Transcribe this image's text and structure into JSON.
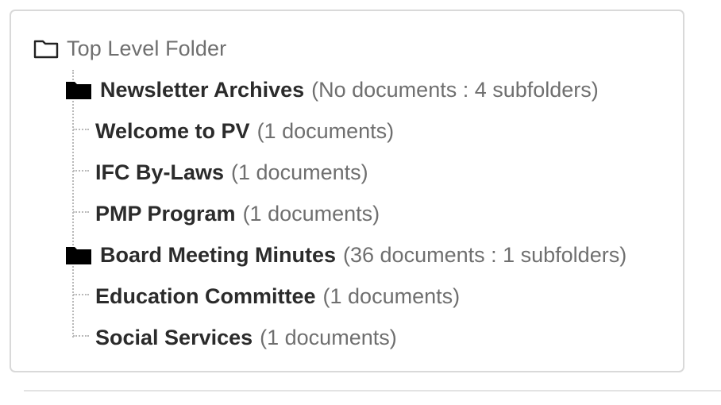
{
  "tree": {
    "root_label": "Top Level Folder",
    "items": [
      {
        "type": "folder",
        "name": "Newsletter Archives",
        "count": "(No documents : 4 subfolders)"
      },
      {
        "type": "document",
        "name": "Welcome to PV",
        "count": "(1 documents)"
      },
      {
        "type": "document",
        "name": "IFC By-Laws",
        "count": "(1 documents)"
      },
      {
        "type": "document",
        "name": "PMP Program",
        "count": "(1 documents)"
      },
      {
        "type": "folder",
        "name": "Board Meeting Minutes",
        "count": "(36 documents : 1 subfolders)"
      },
      {
        "type": "document",
        "name": "Education Committee",
        "count": "(1 documents)"
      },
      {
        "type": "document",
        "name": "Social Services",
        "count": "(1 documents)"
      }
    ]
  },
  "icons": {
    "root": "folder-outline-icon",
    "folder": "folder-filled-icon"
  },
  "colors": {
    "name_text": "#2b2b2b",
    "count_text": "#6f6f6f",
    "border": "#d9d9d9",
    "tree_line": "#b9b9b9"
  }
}
